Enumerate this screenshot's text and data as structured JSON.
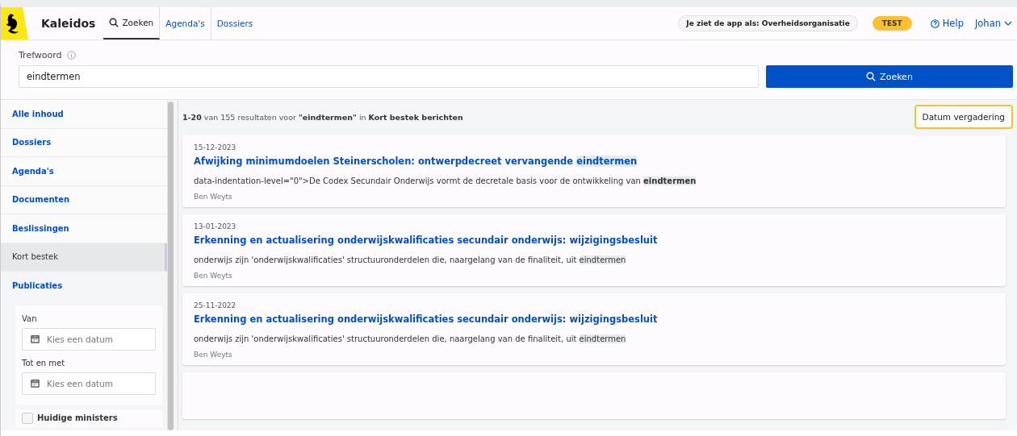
{
  "header": {
    "app_name": "Kaleidos",
    "tabs": [
      {
        "label": "Zoeken",
        "kind": "search",
        "selected": true
      },
      {
        "label": "Agenda's",
        "kind": "link",
        "selected": false
      },
      {
        "label": "Dossiers",
        "kind": "link",
        "selected": false
      }
    ],
    "role_badge": "Je ziet de app als: Overheidsorganisatie",
    "env_badge": "TEST",
    "help": "Help",
    "user": "Johan"
  },
  "search": {
    "label": "Trefwoord",
    "value": "eindtermen",
    "button": "Zoeken"
  },
  "sidebar": {
    "items": [
      {
        "label": "Alle inhoud",
        "selected": false
      },
      {
        "label": "Dossiers",
        "selected": false
      },
      {
        "label": "Agenda's",
        "selected": false
      },
      {
        "label": "Documenten",
        "selected": false
      },
      {
        "label": "Beslissingen",
        "selected": false
      },
      {
        "label": "Kort bestek",
        "selected": true
      },
      {
        "label": "Publicaties",
        "selected": false
      }
    ],
    "date_filters": [
      {
        "label": "Van",
        "placeholder": "Kies een datum"
      },
      {
        "label": "Tot en met",
        "placeholder": "Kies een datum"
      }
    ],
    "checkbox": {
      "label": "Huidige ministers",
      "checked": false
    }
  },
  "results": {
    "summary": "**1-20** van 155 resultaten voor **\"eindtermen\"** in **Kort bestek berichten**",
    "sort_button": "Datum vergadering",
    "items": [
      {
        "date": "15-12-2023",
        "title": [
          {
            "text": "Afwijking minimumdoelen Steinerscholen: ontwerpdecreet vervangende ",
            "highlighted": false
          },
          {
            "text": "eindtermen",
            "highlighted": true
          }
        ],
        "snippet": [
          {
            "text": "data-indentation-level=\"0\">De Codex Secundair Onderwijs vormt de decretale basis voor de ontwikkeling van ",
            "highlighted": false
          },
          {
            "text": "**eindtermen**",
            "highlighted": true
          }
        ],
        "author": "Ben Weyts"
      },
      {
        "date": "13-01-2023",
        "title": [
          {
            "text": "Erkenning en actualisering onderwijskwalificaties secundair onderwijs: wijzigingsbesluit",
            "highlighted": false
          }
        ],
        "snippet": [
          {
            "text": "onderwijs zijn 'onderwijskwalificaties' structuuronderdelen die, naargelang van de finaliteit, uit ",
            "highlighted": false
          },
          {
            "text": "eindtermen",
            "highlighted": true
          }
        ],
        "author": "Ben Weyts"
      },
      {
        "date": "25-11-2022",
        "title": [
          {
            "text": "Erkenning en actualisering onderwijskwalificaties secundair onderwijs: wijzigingsbesluit",
            "highlighted": false
          }
        ],
        "snippet": [
          {
            "text": "onderwijs zijn 'onderwijskwalificaties' structuuronderdelen die, naargelang van de finaliteit, uit ",
            "highlighted": false
          },
          {
            "text": "eindtermen",
            "highlighted": true
          }
        ],
        "author": "Ben Weyts"
      }
    ]
  }
}
